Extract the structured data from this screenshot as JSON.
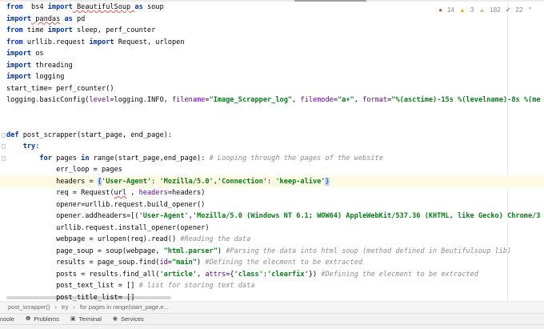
{
  "indicators": {
    "errors": "14",
    "warnings": "3",
    "weak_warnings": "182",
    "typos": "22"
  },
  "code": [
    [
      [
        "kw",
        "from"
      ],
      [
        "",
        "  bs4 "
      ],
      [
        "kw",
        "import"
      ],
      [
        "ul",
        " BeautifulSoup "
      ],
      [
        "kw",
        "as"
      ],
      [
        "",
        " soup"
      ]
    ],
    [
      [
        "kw",
        "import"
      ],
      [
        "ul",
        " pandas"
      ],
      [
        "",
        " "
      ],
      [
        "kw",
        "as"
      ],
      [
        "",
        " pd"
      ]
    ],
    [
      [
        "kw",
        "from"
      ],
      [
        "",
        " time "
      ],
      [
        "kw",
        "import"
      ],
      [
        "",
        " sleep, perf_counter"
      ]
    ],
    [
      [
        "kw",
        "from"
      ],
      [
        "",
        " urllib.request "
      ],
      [
        "kw",
        "import"
      ],
      [
        "",
        " Request, urlopen"
      ]
    ],
    [
      [
        "kw",
        "import"
      ],
      [
        "",
        " os"
      ]
    ],
    [
      [
        "kw",
        "import"
      ],
      [
        "",
        " threading"
      ]
    ],
    [
      [
        "kw",
        "import"
      ],
      [
        "",
        " logging"
      ]
    ],
    [
      [
        "",
        "start_time= perf_counter()"
      ]
    ],
    [
      [
        "",
        "logging.basicConfig("
      ],
      [
        "kwa",
        "level"
      ],
      [
        "",
        "=logging.INFO, "
      ],
      [
        "kwa",
        "filename"
      ],
      [
        "",
        "="
      ],
      [
        "str",
        "\"Image_Scrapper_log\""
      ],
      [
        "",
        ", "
      ],
      [
        "kwa",
        "filemode"
      ],
      [
        "",
        "="
      ],
      [
        "str",
        "\"a+\""
      ],
      [
        "",
        ", "
      ],
      [
        "kwa",
        "format"
      ],
      [
        "",
        "="
      ],
      [
        "str",
        "\"%(asctime)-15s %(levelname)-8s %(me"
      ]
    ],
    [],
    [],
    [
      [
        "kw",
        "def"
      ],
      [
        "",
        " post_scrapper(start_page, end_page):"
      ]
    ],
    [
      [
        "",
        "    "
      ],
      [
        "kw",
        "try"
      ],
      [
        "",
        ":"
      ]
    ],
    [
      [
        "",
        "        "
      ],
      [
        "kw",
        "for"
      ],
      [
        "",
        " pages "
      ],
      [
        "kw",
        "in"
      ],
      [
        "",
        " range(start_page,end_page): "
      ],
      [
        "cm",
        "# Looping through the pages of the website"
      ]
    ],
    [
      [
        "",
        "            err_loop = pages"
      ]
    ],
    [
      [
        "",
        "            headers = "
      ],
      [
        "br",
        "{"
      ],
      [
        "str",
        "'User-Agent'"
      ],
      [
        "",
        ": "
      ],
      [
        "str",
        "'Mozilla/5.0'"
      ],
      [
        "",
        ","
      ],
      [
        "str",
        "'Connection'"
      ],
      [
        "",
        ": "
      ],
      [
        "str",
        "'keep-alive'"
      ],
      [
        "br",
        "}"
      ]
    ],
    [
      [
        "",
        "            req = Request("
      ],
      [
        "ul",
        "url"
      ],
      [
        "",
        " , "
      ],
      [
        "kwa",
        "headers"
      ],
      [
        "",
        "=headers)"
      ]
    ],
    [
      [
        "",
        "            opener=urllib.request.build_opener()"
      ]
    ],
    [
      [
        "",
        "            opener.addheaders=[("
      ],
      [
        "str",
        "'User-Agent'"
      ],
      [
        "",
        ","
      ],
      [
        "str",
        "'Mozilla/5.0 (Windows NT 6.1; WOW64) AppleWebKit/537.36 (KHTML, like Gecko) Chrome/3"
      ]
    ],
    [
      [
        "",
        "            urllib.request.install_opener(opener)"
      ]
    ],
    [
      [
        "",
        "            webpage = urlopen(req).read() "
      ],
      [
        "cm",
        "#Reading the data"
      ]
    ],
    [
      [
        "",
        "            page_soup = soup(webpage, "
      ],
      [
        "str",
        "\"html.parser\""
      ],
      [
        "",
        ") "
      ],
      [
        "cm",
        "#Parsing the data into html soup (method defined in Beutifulsoup lib)"
      ]
    ],
    [
      [
        "",
        "            results = page_soup.find("
      ],
      [
        "kwa",
        "id"
      ],
      [
        "",
        "="
      ],
      [
        "str",
        "\"main\""
      ],
      [
        "",
        ") "
      ],
      [
        "cm",
        "#Defining the elecment to be extracted"
      ]
    ],
    [
      [
        "",
        "            posts = results.find_all("
      ],
      [
        "str",
        "'article'"
      ],
      [
        "",
        ", "
      ],
      [
        "kwa",
        "attrs"
      ],
      [
        "",
        "={"
      ],
      [
        "str",
        "'class'"
      ],
      [
        "",
        ":"
      ],
      [
        "str",
        "'clearfix'"
      ],
      [
        "",
        "}) "
      ],
      [
        "cm",
        "#Defining the elecment to be extracted"
      ]
    ],
    [
      [
        "",
        "            post_text_list = [] "
      ],
      [
        "cm",
        "# list for storing text data"
      ]
    ],
    [
      [
        "",
        "            post_title_list= []"
      ]
    ]
  ],
  "breadcrumbs": [
    "post_scrapper()",
    "try",
    "for pages in range(start_page,e..."
  ],
  "tool_windows": [
    {
      "icon": "console",
      "label": "nsole"
    },
    {
      "icon": "problems",
      "label": "Problems"
    },
    {
      "icon": "terminal",
      "label": "Terminal"
    },
    {
      "icon": "services",
      "label": "Services"
    }
  ]
}
